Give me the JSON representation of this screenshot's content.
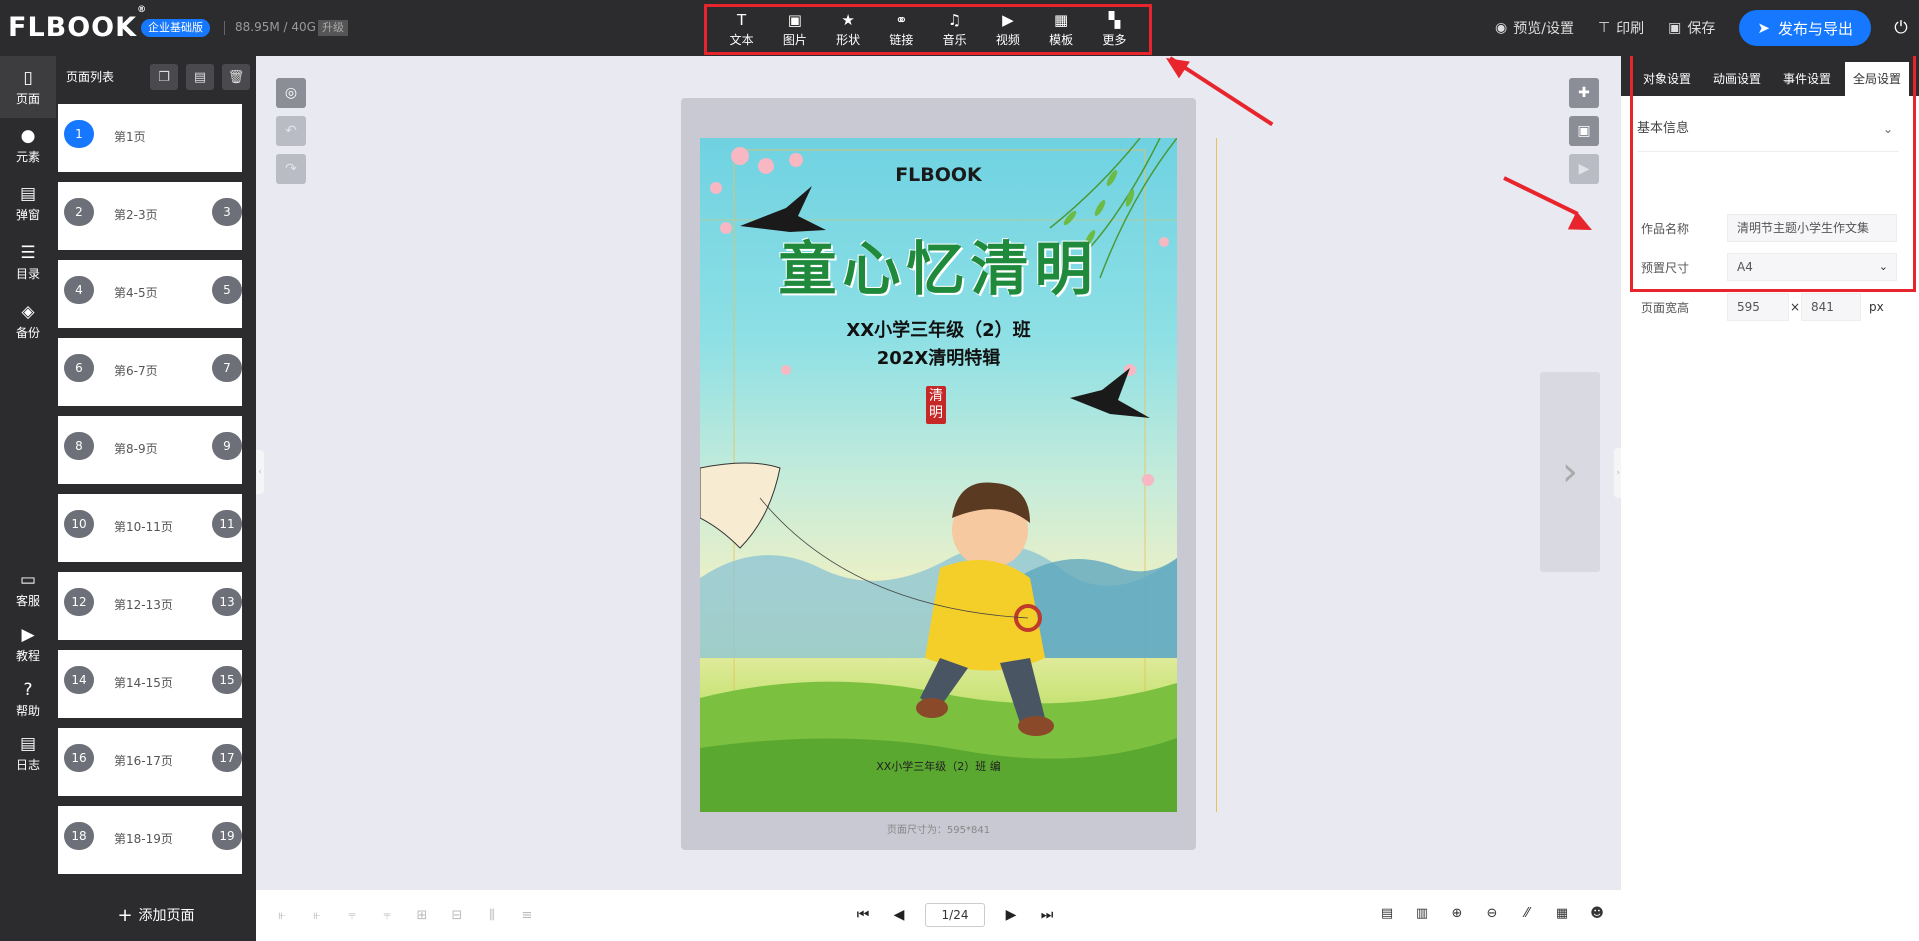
{
  "app": {
    "logo": "FLBOOK",
    "logo_mark": "®",
    "plan_badge": "企业基础版",
    "storage": "88.95M / 40G",
    "upgrade_label": "升级"
  },
  "toolbar": {
    "items": [
      {
        "label": "文本",
        "icon": "text-icon",
        "glyph": "T"
      },
      {
        "label": "图片",
        "icon": "image-icon",
        "glyph": "▣"
      },
      {
        "label": "形状",
        "icon": "star-icon",
        "glyph": "★"
      },
      {
        "label": "链接",
        "icon": "link-icon",
        "glyph": "⚭"
      },
      {
        "label": "音乐",
        "icon": "music-icon",
        "glyph": "♫"
      },
      {
        "label": "视频",
        "icon": "video-icon",
        "glyph": "▶"
      },
      {
        "label": "模板",
        "icon": "template-icon",
        "glyph": "▦"
      },
      {
        "label": "更多",
        "icon": "more-icon",
        "glyph": "▚"
      }
    ]
  },
  "top_right": {
    "preview_label": "预览/设置",
    "print_label": "印刷",
    "save_label": "保存",
    "publish_label": "发布与导出"
  },
  "left_nav": {
    "items": [
      {
        "label": "页面",
        "icon": "page-icon",
        "glyph": "▯"
      },
      {
        "label": "元素",
        "icon": "elements-icon",
        "glyph": "●"
      },
      {
        "label": "弹窗",
        "icon": "popup-icon",
        "glyph": "▤"
      },
      {
        "label": "目录",
        "icon": "catalog-icon",
        "glyph": "☰"
      },
      {
        "label": "备份",
        "icon": "backup-icon",
        "glyph": "◈"
      },
      {
        "label": "客服",
        "icon": "service-icon",
        "glyph": "▭"
      },
      {
        "label": "教程",
        "icon": "tutorial-icon",
        "glyph": "▶"
      },
      {
        "label": "帮助",
        "icon": "help-icon",
        "glyph": "?"
      },
      {
        "label": "日志",
        "icon": "log-icon",
        "glyph": "▤"
      }
    ]
  },
  "page_panel": {
    "title": "页面列表",
    "add_page_label": "添加页面",
    "pages": [
      {
        "num": "1",
        "num2": "",
        "label": "第1页",
        "active": true
      },
      {
        "num": "2",
        "num2": "3",
        "label": "第2-3页"
      },
      {
        "num": "4",
        "num2": "5",
        "label": "第4-5页"
      },
      {
        "num": "6",
        "num2": "7",
        "label": "第6-7页"
      },
      {
        "num": "8",
        "num2": "9",
        "label": "第8-9页"
      },
      {
        "num": "10",
        "num2": "11",
        "label": "第10-11页"
      },
      {
        "num": "12",
        "num2": "13",
        "label": "第12-13页"
      },
      {
        "num": "14",
        "num2": "15",
        "label": "第14-15页"
      },
      {
        "num": "16",
        "num2": "17",
        "label": "第16-17页"
      },
      {
        "num": "18",
        "num2": "19",
        "label": "第18-19页"
      }
    ]
  },
  "cover": {
    "brand": "FLBOOK",
    "title": "童心忆清明",
    "subtitle_1": "XX小学三年级（2）班",
    "subtitle_2": "202X清明特辑",
    "seal_text": "清明",
    "footer_text": "XX小学三年级（2）班 编",
    "size_info": "页面尺寸为：595*841"
  },
  "right_panel": {
    "tabs": [
      "对象设置",
      "动画设置",
      "事件设置",
      "全局设置"
    ],
    "active_tab": 3,
    "section_title": "基本信息",
    "work_name_label": "作品名称",
    "work_name_value": "清明节主题小学生作文集",
    "preset_label": "预置尺寸",
    "preset_value": "A4",
    "page_wh_label": "页面宽高",
    "page_width": "595",
    "times_sign": "×",
    "page_height": "841",
    "unit": "px"
  },
  "bottom_bar": {
    "page_indicator": "1/24"
  },
  "colors": {
    "accent": "#1677ff",
    "dark_bg": "#2c2c2e",
    "highlight_red": "#e8252d"
  }
}
